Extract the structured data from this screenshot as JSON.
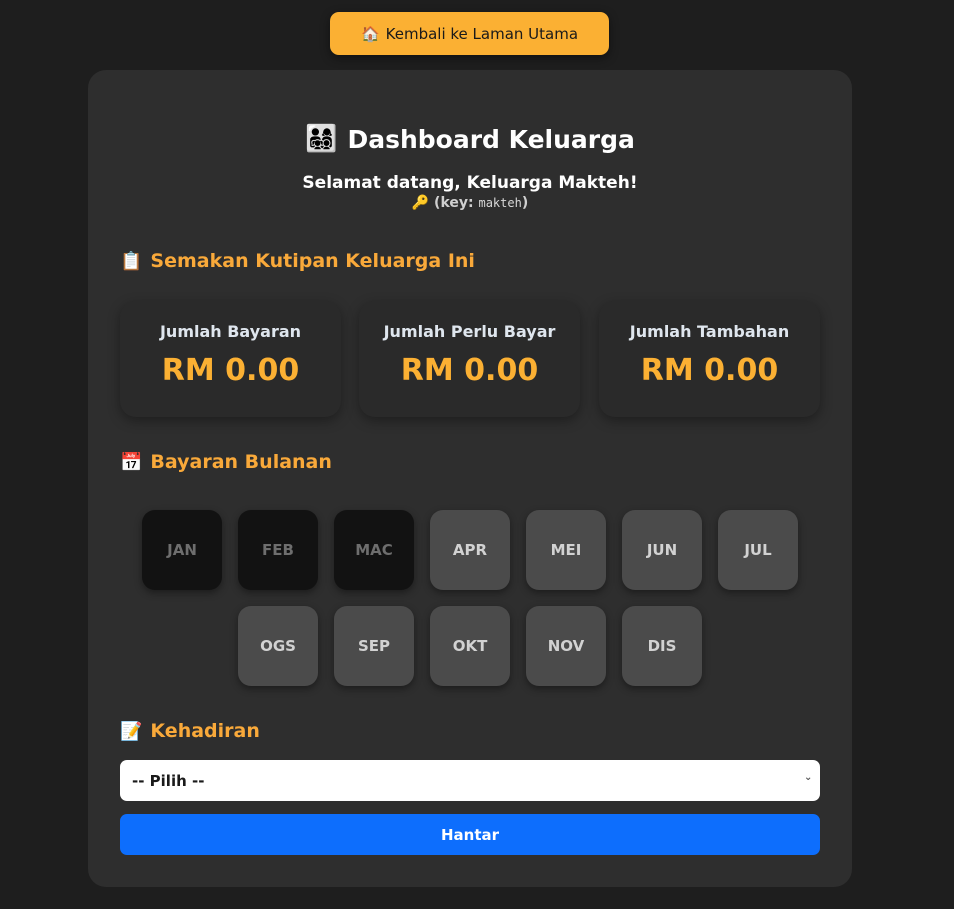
{
  "home_button": {
    "icon": "house-icon",
    "icon_glyph": "🏠",
    "label": "Kembali ke Laman Utama"
  },
  "header": {
    "icon": "family-icon",
    "icon_glyph": "👨‍👩‍👧‍👦",
    "title": "Dashboard Keluarga",
    "welcome": "Selamat datang, Keluarga Makteh!",
    "key_icon_glyph": "🔑",
    "key_prefix": "(key:",
    "key_value": "makteh",
    "key_suffix": ")"
  },
  "collection_section": {
    "icon": "clipboard-icon",
    "icon_glyph": "📋",
    "heading": "Semakan Kutipan Keluarga Ini",
    "stats": [
      {
        "label": "Jumlah Bayaran",
        "value": "RM 0.00"
      },
      {
        "label": "Jumlah Perlu Bayar",
        "value": "RM 0.00"
      },
      {
        "label": "Jumlah Tambahan",
        "value": "RM 0.00"
      }
    ]
  },
  "monthly_section": {
    "icon": "calendar-icon",
    "icon_glyph": "📅",
    "heading": "Bayaran Bulanan",
    "months": [
      {
        "label": "JAN",
        "state": "dark"
      },
      {
        "label": "FEB",
        "state": "dark"
      },
      {
        "label": "MAC",
        "state": "dark"
      },
      {
        "label": "APR",
        "state": "light"
      },
      {
        "label": "MEI",
        "state": "light"
      },
      {
        "label": "JUN",
        "state": "light"
      },
      {
        "label": "JUL",
        "state": "light"
      },
      {
        "label": "OGS",
        "state": "light"
      },
      {
        "label": "SEP",
        "state": "light"
      },
      {
        "label": "OKT",
        "state": "light"
      },
      {
        "label": "NOV",
        "state": "light"
      },
      {
        "label": "DIS",
        "state": "light"
      }
    ]
  },
  "attendance_section": {
    "icon": "memo-icon",
    "icon_glyph": "📝",
    "heading": "Kehadiran",
    "select_value": "-- Pilih --",
    "submit_label": "Hantar"
  },
  "colors": {
    "background": "#1e1e1e",
    "card": "#2e2e2e",
    "accent": "#fbb033",
    "heading_accent": "#f9a93a",
    "primary_button": "#0d6efd",
    "month_paid": "#121212",
    "month_unpaid": "#4b4b4b"
  }
}
